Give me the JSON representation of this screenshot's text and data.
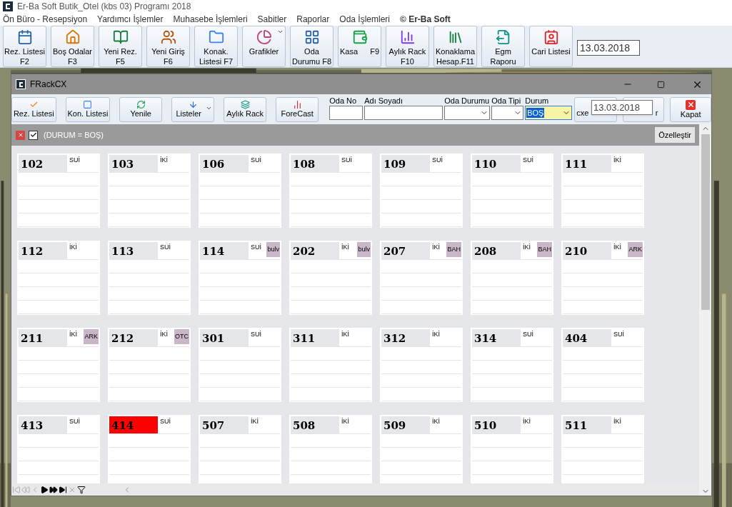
{
  "window": {
    "title": "Er-Ba Soft  Butik_Otel (kbs 03) Programı 2018"
  },
  "menu": [
    {
      "label": "Ön Büro - Resepsiyon",
      "bold": false
    },
    {
      "label": "Yardımcı İşlemler",
      "bold": false
    },
    {
      "label": "Muhasebe İşlemleri",
      "bold": false
    },
    {
      "label": "Sabitler",
      "bold": false
    },
    {
      "label": "Raporlar",
      "bold": false
    },
    {
      "label": "Oda İşlemleri",
      "bold": false
    },
    {
      "label": "© Er-Ba Soft",
      "bold": true
    }
  ],
  "toolbar": {
    "buttons": [
      {
        "kind": "calendar",
        "lines": [
          "Rez. Listesi",
          "F2"
        ]
      },
      {
        "kind": "house",
        "lines": [
          "Boş Odalar",
          "F3"
        ]
      },
      {
        "kind": "book",
        "lines": [
          "Yeni Rez.",
          "F5"
        ]
      },
      {
        "kind": "people",
        "lines": [
          "Yeni Giriş",
          "F6"
        ]
      },
      {
        "kind": "folder",
        "lines": [
          "Konak.",
          "Listesi  F7"
        ]
      },
      {
        "kind": "pie",
        "lines": [
          "Grafikler"
        ],
        "dropdown": true
      },
      {
        "kind": "grid",
        "lines": [
          "Oda",
          "Durumu  F8"
        ]
      },
      {
        "kind": "cash",
        "lines": [
          "Kasa",
          "F9"
        ],
        "split": true
      },
      {
        "kind": "bars",
        "lines": [
          "Aylık Rack",
          "F10"
        ]
      },
      {
        "kind": "books",
        "lines": [
          "Konaklama",
          "Hesap.F11"
        ]
      },
      {
        "kind": "report",
        "lines": [
          "Egm",
          "Raporu"
        ]
      },
      {
        "kind": "contact",
        "lines": [
          "Cari Listesi"
        ]
      }
    ],
    "date": "13.03.2018"
  },
  "rack_window": {
    "title": "FRackCX",
    "buttons": [
      {
        "kind": "check",
        "label": "Rez. Listesi"
      },
      {
        "kind": "square",
        "label": "Kon. Listesi"
      },
      {
        "kind": "refresh",
        "label": "Yenile"
      },
      {
        "kind": "arrow",
        "label": "Listeler",
        "dropdown": true
      },
      {
        "kind": "rack",
        "label": "Aylık Rack"
      },
      {
        "kind": "chart",
        "label": "ForeCast"
      }
    ],
    "filters": [
      {
        "label": "Oda No",
        "kind": "text"
      },
      {
        "label": "Adı Soyadı",
        "kind": "text"
      },
      {
        "label": "Oda Durumu",
        "kind": "select"
      },
      {
        "label": "Oda Tipi",
        "kind": "select"
      },
      {
        "label": "Durum",
        "kind": "select",
        "value": "BOŞ"
      }
    ],
    "excel_button": {
      "label": "cxe"
    },
    "print_button": {
      "label": "r"
    },
    "date_popup": "13.03.2018",
    "close_button": {
      "label": "Kapat"
    },
    "filter_bar": {
      "checked": true,
      "text": "(DURUM = BOŞ)",
      "customize": "Özelleştir"
    },
    "rooms": [
      {
        "number": "102",
        "type": "SUİ",
        "highlight": false
      },
      {
        "number": "103",
        "type": "İKİ",
        "highlight": false
      },
      {
        "number": "106",
        "type": "SUİ",
        "highlight": false
      },
      {
        "number": "108",
        "type": "SUİ",
        "highlight": false
      },
      {
        "number": "109",
        "type": "SUİ",
        "highlight": false
      },
      {
        "number": "110",
        "type": "SUİ",
        "highlight": false
      },
      {
        "number": "111",
        "type": "İKİ",
        "highlight": false
      },
      {
        "number": "112",
        "type": "İKİ",
        "highlight": false
      },
      {
        "number": "113",
        "type": "SUİ",
        "highlight": false
      },
      {
        "number": "114",
        "type": "SUİ",
        "tag": "bulv",
        "highlight": false
      },
      {
        "number": "202",
        "type": "İKİ",
        "tag": "bulv",
        "highlight": false
      },
      {
        "number": "207",
        "type": "İKİ",
        "tag": "BAH",
        "highlight": false
      },
      {
        "number": "208",
        "type": "İKİ",
        "tag": "BAH",
        "highlight": false
      },
      {
        "number": "210",
        "type": "İKİ",
        "tag": "ARK",
        "highlight": false
      },
      {
        "number": "211",
        "type": "İKİ",
        "tag": "ARK",
        "highlight": false
      },
      {
        "number": "212",
        "type": "İKİ",
        "tag": "OTC",
        "highlight": false
      },
      {
        "number": "301",
        "type": "SUİ",
        "highlight": false
      },
      {
        "number": "311",
        "type": "İKİ",
        "highlight": false
      },
      {
        "number": "312",
        "type": "İKİ",
        "highlight": false
      },
      {
        "number": "314",
        "type": "SUİ",
        "highlight": false
      },
      {
        "number": "404",
        "type": "SUİ",
        "highlight": false
      },
      {
        "number": "413",
        "type": "SUİ",
        "highlight": false
      },
      {
        "number": "414",
        "type": "SUİ",
        "highlight": true
      },
      {
        "number": "507",
        "type": "İKİ",
        "highlight": false
      },
      {
        "number": "508",
        "type": "İKİ",
        "highlight": false
      },
      {
        "number": "509",
        "type": "İKİ",
        "highlight": false
      },
      {
        "number": "510",
        "type": "İKİ",
        "highlight": false
      },
      {
        "number": "511",
        "type": "İKİ",
        "highlight": false
      }
    ]
  }
}
